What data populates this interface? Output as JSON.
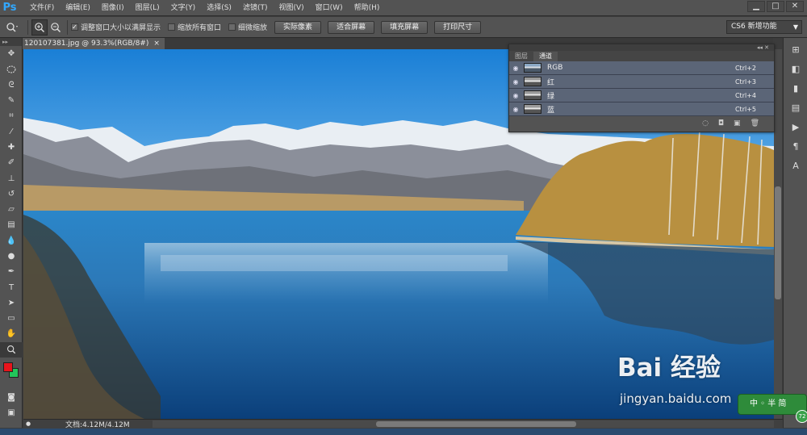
{
  "app": {
    "logo": "Ps"
  },
  "menu": [
    "文件(F)",
    "编辑(E)",
    "图像(I)",
    "图层(L)",
    "文字(Y)",
    "选择(S)",
    "滤镜(T)",
    "视图(V)",
    "窗口(W)",
    "帮助(H)"
  ],
  "window_controls": {
    "minimize": "▁",
    "maximize": "□",
    "close": "✕"
  },
  "options": {
    "zoom_in_icon": "zoom-in-icon",
    "checkbox_resize_windows": "调整窗口大小以满屏显示",
    "checkbox_zoom_all": "缩放所有窗口",
    "checkbox_scrubby_zoom": "细微缩放",
    "btn_actual_pixels": "实际像素",
    "btn_fit_screen": "适合屏幕",
    "btn_fill_screen": "填充屏幕",
    "btn_print_size": "打印尺寸",
    "workspace": "CS6 新增功能"
  },
  "document": {
    "tab_title": "120107381.jpg @ 93.3%(RGB/8#)",
    "tab_close": "×",
    "doc_size": "文档:4.12M/4.12M"
  },
  "channels_panel": {
    "tabs": [
      "图层",
      "通道"
    ],
    "active_tab": "通道",
    "collapse": "◂◂ ✕",
    "rows": [
      {
        "name": "RGB",
        "shortcut": "Ctrl+2"
      },
      {
        "name": "红",
        "shortcut": "Ctrl+3"
      },
      {
        "name": "绿",
        "shortcut": "Ctrl+4"
      },
      {
        "name": "蓝",
        "shortcut": "Ctrl+5"
      }
    ]
  },
  "watermark": {
    "logo": "Bai 经验",
    "url": "jingyan.baidu.com"
  },
  "ime": {
    "label": "中 ◦ 半 简",
    "badge": "72"
  },
  "colors": {
    "foreground": "#e8151b",
    "background": "#22c65a",
    "ps_blue": "#31a8ff"
  }
}
